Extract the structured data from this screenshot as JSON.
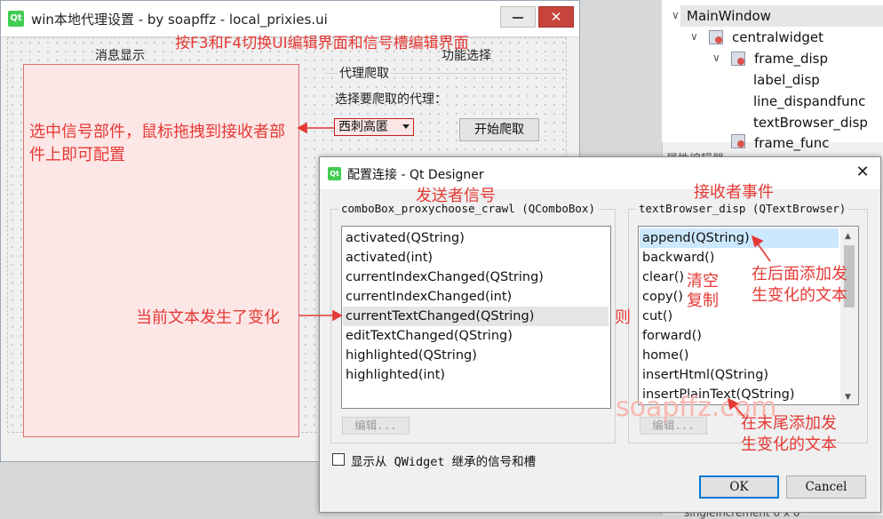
{
  "background_window": {
    "app_icon": "Qt",
    "title": "win本地代理设置 - by soapffz - local_prixies.ui",
    "close_glyph": "✕",
    "message_label": "消息显示",
    "function_label": "功能选择",
    "crawl_group_label": "代理爬取",
    "choose_proxy_label": "选择要爬取的代理：",
    "proxy_combo_value": "西刺高匿",
    "start_button": "开始爬取"
  },
  "object_tree": {
    "items": [
      {
        "label": "MainWindow"
      },
      {
        "label": "centralwidget"
      },
      {
        "label": "frame_disp"
      },
      {
        "label": "label_disp"
      },
      {
        "label": "line_dispandfunc"
      },
      {
        "label": "textBrowser_disp"
      },
      {
        "label": "frame_func"
      }
    ],
    "property_editor_header": "属性编辑器",
    "bottom_row": "singleIncrement   0 x 0"
  },
  "dialog": {
    "icon": "Qt",
    "title": "配置连接 - Qt Designer",
    "close_glyph": "✕",
    "sender_group_title": "comboBox_proxychoose_crawl (QComboBox)",
    "receiver_group_title": "textBrowser_disp (QTextBrowser)",
    "signals": [
      "activated(QString)",
      "activated(int)",
      "currentIndexChanged(QString)",
      "currentIndexChanged(int)",
      "currentTextChanged(QString)",
      "editTextChanged(QString)",
      "highlighted(QString)",
      "highlighted(int)"
    ],
    "selected_signal": "currentTextChanged(QString)",
    "slots": [
      "append(QString)",
      "backward()",
      "clear()",
      "copy()",
      "cut()",
      "forward()",
      "home()",
      "insertHtml(QString)",
      "insertPlainText(QString)"
    ],
    "selected_slot": "append(QString)",
    "edit_button_left": "编辑...",
    "edit_button_right": "编辑...",
    "inherited_checkbox_label": "显示从 QWidget 继承的信号和槽",
    "inherited_checkbox_checked": false,
    "ok_button": "OK",
    "cancel_button": "Cancel"
  },
  "annotations": {
    "top_hint": "按F3和F4切换UI编辑界面和信号槽编辑界面",
    "drag_hint": "选中信号部件，鼠标拖拽到接收者部件上即可配置",
    "sender_signal": "发送者信号",
    "receiver_event": "接收者事件",
    "text_changed": "当前文本发生了变化",
    "then": "则",
    "clear_note": "清空",
    "copy_note": "复制",
    "append_note": "在后面添加发生变化的文本",
    "insert_note": "在末尾添加发生变化的文本",
    "watermark": "soapffz.com",
    "color": "#e53935"
  },
  "colors": {
    "highlight_blue": "#cce8ff",
    "highlight_gray": "#e5e5e5",
    "widget_pink": "#fde6e6",
    "qt_green": "#41cd52",
    "close_red": "#c7443a"
  }
}
